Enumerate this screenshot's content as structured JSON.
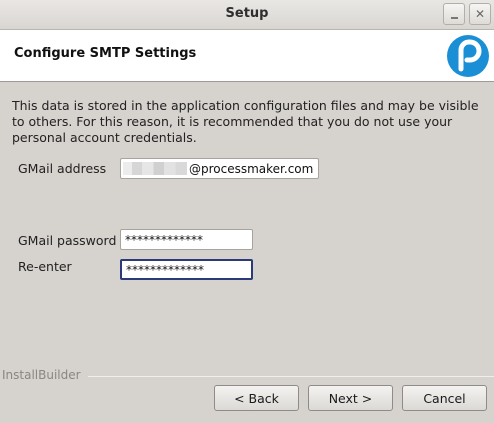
{
  "window": {
    "title": "Setup"
  },
  "header": {
    "page_title": "Configure SMTP Settings",
    "logo_icon": "processmaker-logo-icon",
    "logo_color": "#1a8fd6"
  },
  "body": {
    "description": "This data is stored in the application configuration files and may be visible to others. For this reason, it is recommended that you do not use your personal account credentials.",
    "email_label": "GMail address",
    "email_value": "@processmaker.com",
    "password_label": "GMail password",
    "password_value": "*************",
    "reenter_label": "Re-enter",
    "reenter_value": "*************"
  },
  "footer": {
    "brand": "InstallBuilder",
    "back_label": "< Back",
    "next_label": "Next >",
    "cancel_label": "Cancel"
  }
}
